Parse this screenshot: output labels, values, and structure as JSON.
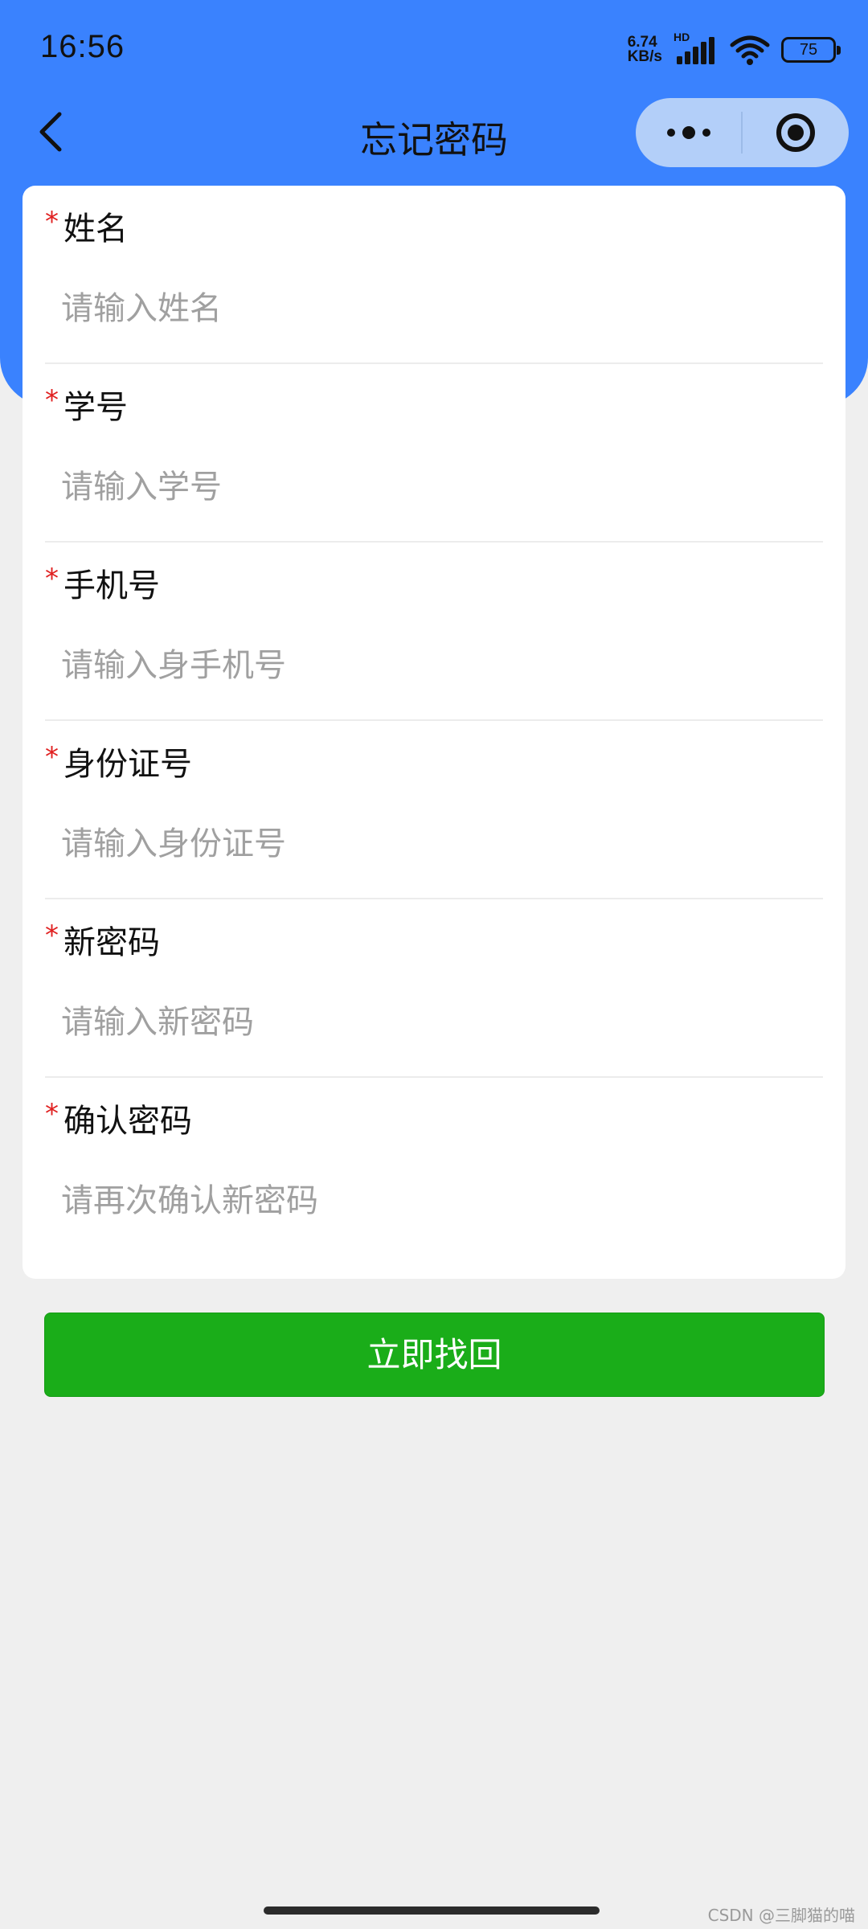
{
  "status_bar": {
    "time": "16:56",
    "net_speed_value": "6.74",
    "net_speed_unit": "KB/s",
    "hd_label": "HD",
    "battery_level": "75"
  },
  "nav": {
    "title": "忘记密码"
  },
  "form": {
    "fields": [
      {
        "required": "*",
        "label": "姓名",
        "placeholder": "请输入姓名",
        "value": ""
      },
      {
        "required": "*",
        "label": "学号",
        "placeholder": "请输入学号",
        "value": ""
      },
      {
        "required": "*",
        "label": "手机号",
        "placeholder": "请输入身手机号",
        "value": ""
      },
      {
        "required": "*",
        "label": "身份证号",
        "placeholder": "请输入身份证号",
        "value": ""
      },
      {
        "required": "*",
        "label": "新密码",
        "placeholder": "请输入新密码",
        "value": ""
      },
      {
        "required": "*",
        "label": "确认密码",
        "placeholder": "请再次确认新密码",
        "value": ""
      }
    ],
    "submit_label": "立即找回"
  },
  "watermark": "CSDN @三脚猫的喵",
  "colors": {
    "header": "#3a82fe",
    "capsule": "#b3cff9",
    "submit": "#1aad19",
    "required": "#e02020",
    "page_background": "#efefef"
  },
  "icons": {
    "back": "chevron-left-icon",
    "more": "more-dots-icon",
    "close": "target-circle-icon",
    "signal": "signal-bars-icon",
    "wifi": "wifi-icon",
    "battery": "battery-icon"
  }
}
